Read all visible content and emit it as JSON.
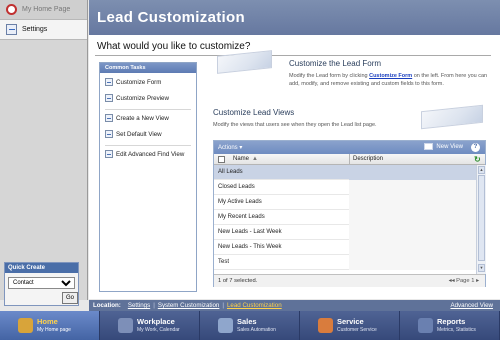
{
  "leftnav": {
    "items": [
      {
        "label": "My Home Page"
      },
      {
        "label": "Settings"
      }
    ]
  },
  "quick_create": {
    "title": "Quick Create",
    "selected": "Contact",
    "go_label": "Go"
  },
  "header": {
    "title": "Lead Customization"
  },
  "main": {
    "question": "What would you like to customize?",
    "common_tasks": {
      "title": "Common Tasks",
      "items": [
        "Customize Form",
        "Customize Preview",
        "Create a New View",
        "Set Default View",
        "Edit Advanced Find View"
      ]
    },
    "form_section": {
      "title": "Customize the Lead Form",
      "desc_pre": "Modify the Lead form by clicking ",
      "desc_link": "Customize Form",
      "desc_post": " on the left. From here you can add, modify, and remove existing and custom fields to this form."
    },
    "views_section": {
      "title": "Customize Lead Views",
      "desc": "Modify the views that users see when they open the Lead list page."
    },
    "grid": {
      "actions_label": "Actions ▾",
      "new_view_label": "New View",
      "col_name": "Name",
      "col_desc": "Description",
      "rows": [
        "All Leads",
        "Closed Leads",
        "My Active Leads",
        "My Recent Leads",
        "New Leads - Last Week",
        "New Leads - This Week",
        "Test"
      ],
      "selected_count": "1 of 7 selected.",
      "page_label": "Page 1"
    }
  },
  "location": {
    "label": "Location:",
    "crumbs": [
      "Settings",
      "System Customization",
      "Lead Customization"
    ],
    "advanced_view": "Advanced View"
  },
  "tabs": [
    {
      "label": "Home",
      "sub": "My Home page",
      "icon_color": "#d8a43a"
    },
    {
      "label": "Workplace",
      "sub": "My Work, Calendar",
      "icon_color": "#7d8fb8"
    },
    {
      "label": "Sales",
      "sub": "Sales Automation",
      "icon_color": "#8fa6cc"
    },
    {
      "label": "Service",
      "sub": "Customer Service",
      "icon_color": "#d97c3d"
    },
    {
      "label": "Reports",
      "sub": "Metrics, Statistics",
      "icon_color": "#6a80b0"
    }
  ]
}
